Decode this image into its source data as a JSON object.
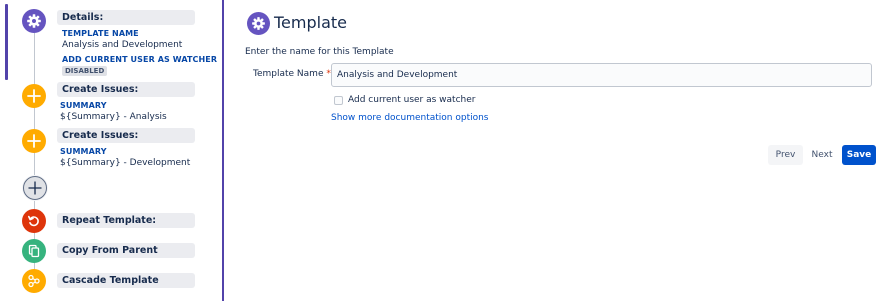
{
  "steps": {
    "details": {
      "title": "Details:",
      "template_name_label": "TEMPLATE NAME",
      "template_name_value": "Analysis and Development",
      "watcher_label": "ADD CURRENT USER AS WATCHER",
      "watcher_value": "DISABLED"
    },
    "create_issues_1": {
      "title": "Create Issues:",
      "summary_label": "SUMMARY",
      "summary_value": "${Summary} - Analysis"
    },
    "create_issues_2": {
      "title": "Create Issues:",
      "summary_label": "SUMMARY",
      "summary_value": "${Summary} - Development"
    },
    "repeat_template": {
      "title": "Repeat Template:"
    },
    "copy_from_parent": {
      "title": "Copy From Parent"
    },
    "cascade_template": {
      "title": "Cascade Template"
    }
  },
  "main": {
    "title": "Template",
    "instruction": "Enter the name for this Template",
    "template_name_label": "Template Name",
    "required_marker": "*",
    "template_name_value": "Analysis and Development",
    "watcher_checkbox_label": "Add current user as watcher",
    "watcher_checked": false,
    "doc_link": "Show more documentation options"
  },
  "buttons": {
    "prev": "Prev",
    "next": "Next",
    "save": "Save"
  },
  "colors": {
    "accent": "#5243aa",
    "details_icon": "#6554c0",
    "create_icon": "#ffab00",
    "repeat_icon": "#de350b",
    "copy_icon": "#36b37e",
    "link": "#0052cc",
    "primary_button": "#0052cc"
  }
}
